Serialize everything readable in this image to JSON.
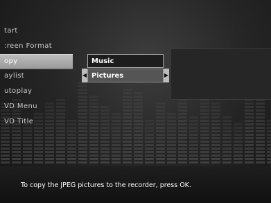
{
  "menu": {
    "items": [
      "tart",
      ":reen Format",
      "opy",
      "aylist",
      "utoplay",
      "VD Menu",
      "VD Title"
    ],
    "selected_index": 2
  },
  "submenu": {
    "items": [
      "Music",
      "Pictures"
    ],
    "selected": "Pictures",
    "left_arrow_icon": "triangle-left",
    "right_arrow_icon": "triangle-right"
  },
  "help": {
    "text": "To copy the JPEG pictures to the recorder, press OK."
  },
  "colors": {
    "background": "#262626",
    "highlight": "#b0b0b0",
    "text": "#ffffff",
    "equalizer": "#5a5a5a"
  }
}
